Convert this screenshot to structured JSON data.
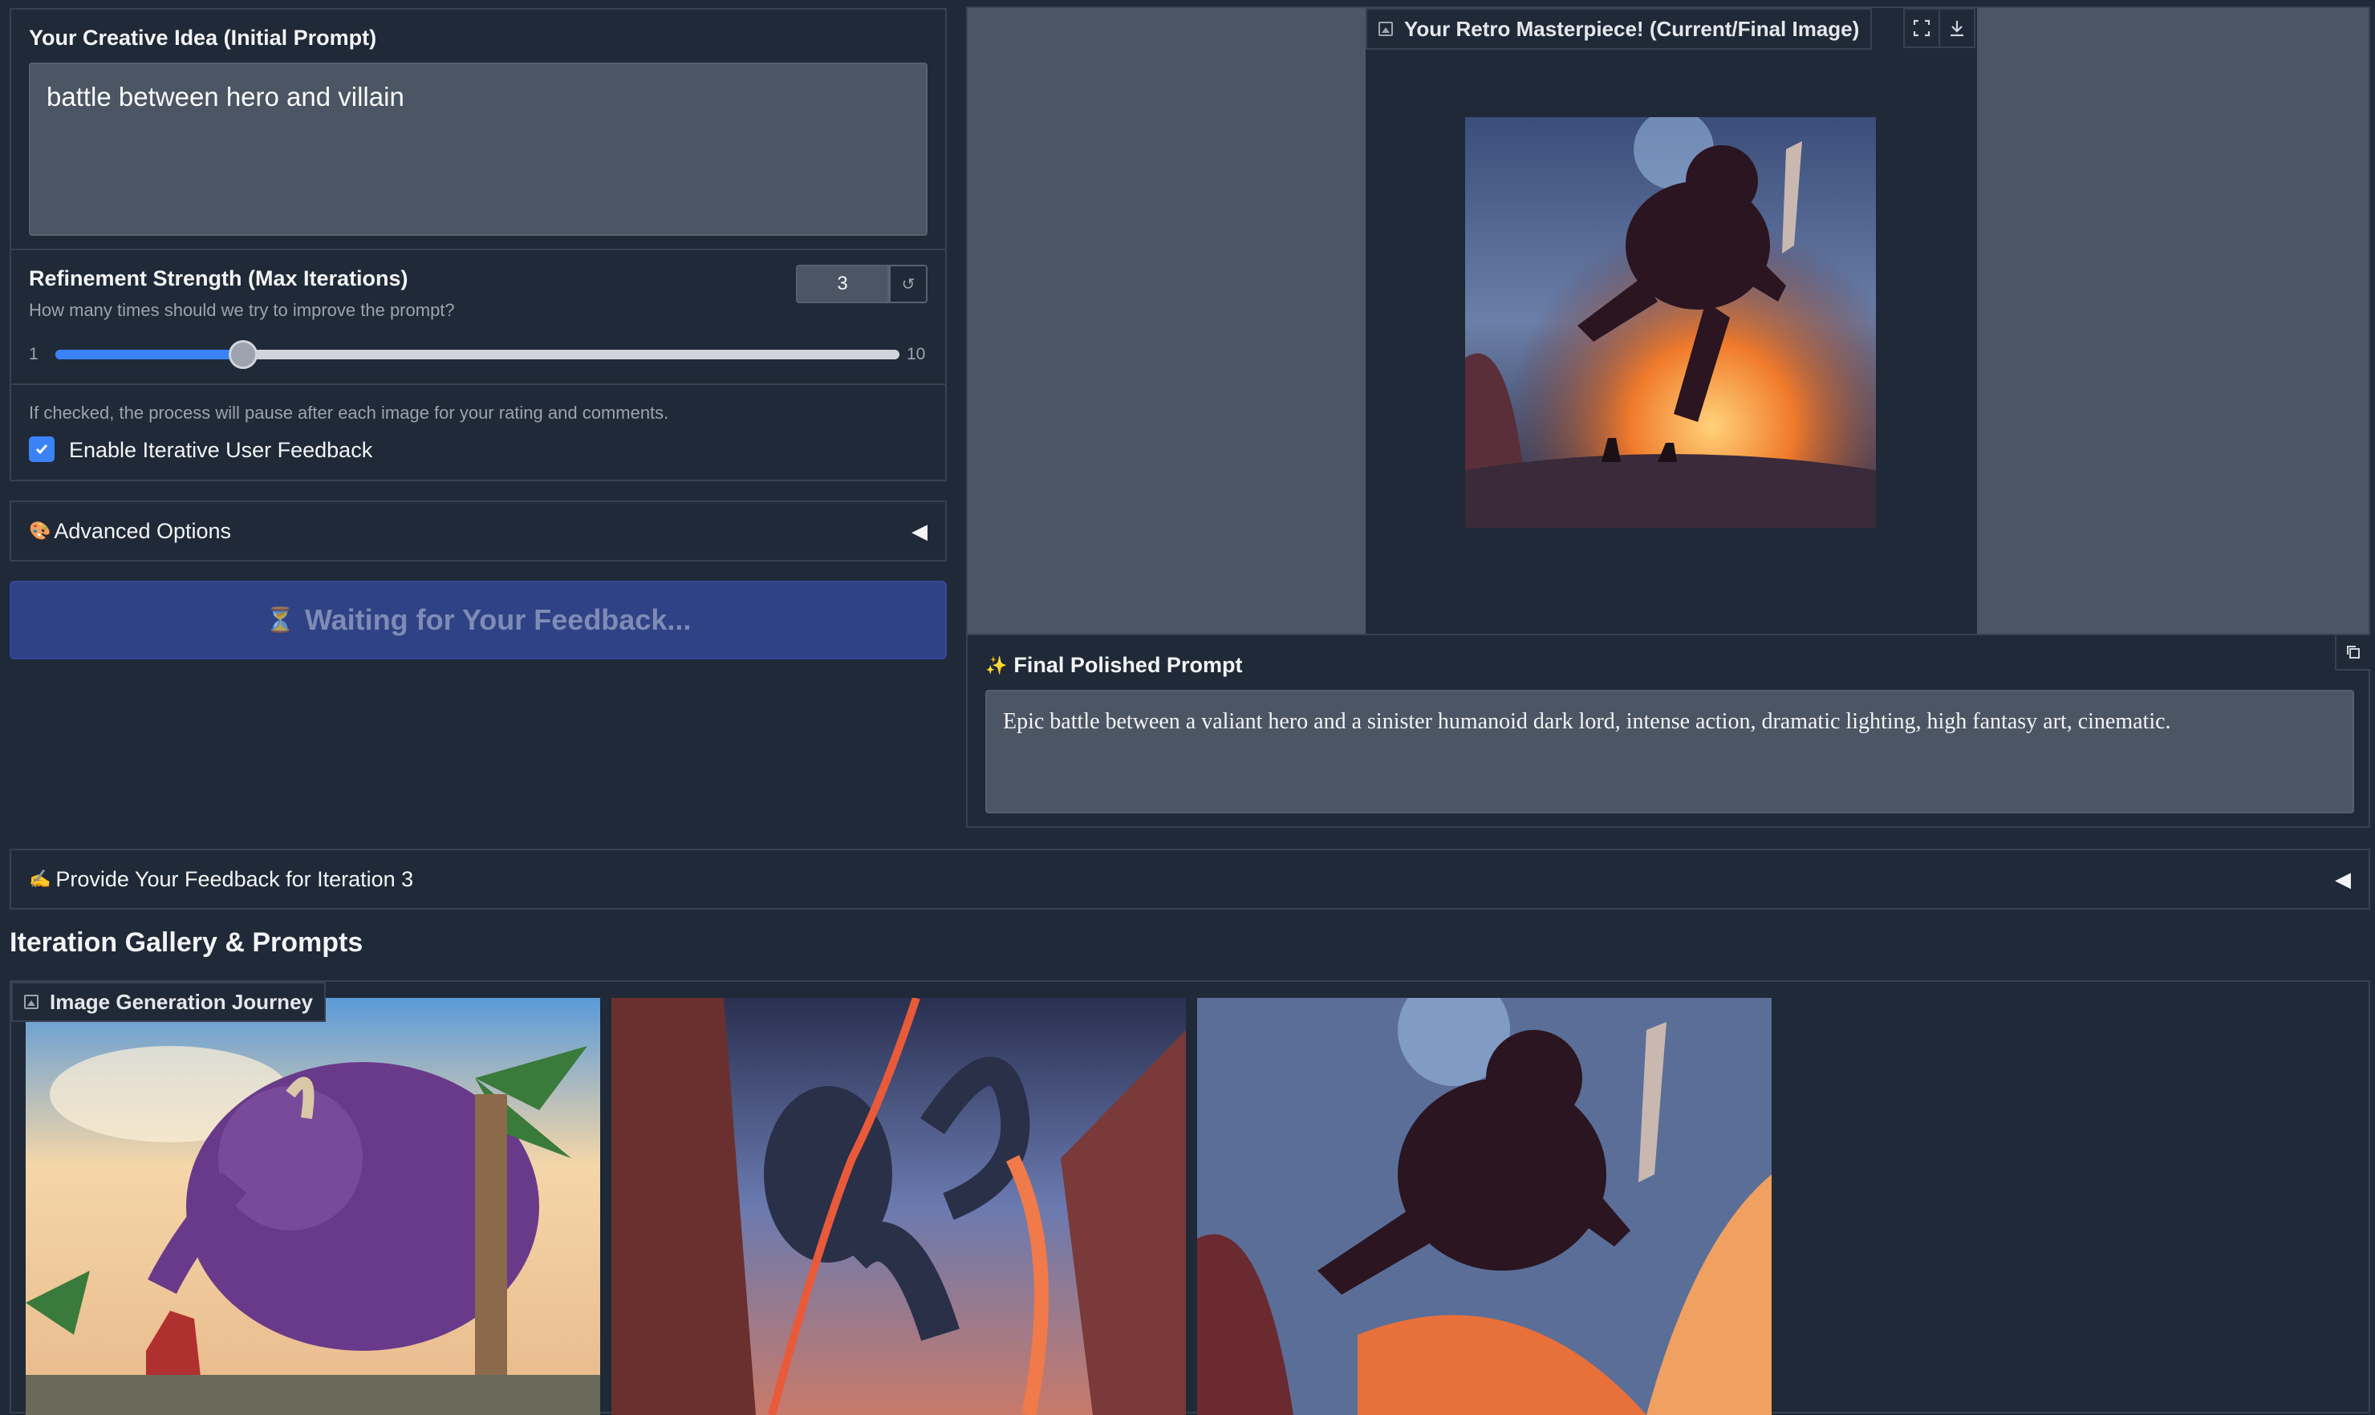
{
  "prompt": {
    "label": "Your Creative Idea (Initial Prompt)",
    "value": "battle between hero and villain"
  },
  "refinement": {
    "label": "Refinement Strength (Max Iterations)",
    "info": "How many times should we try to improve the prompt?",
    "value": "3",
    "reset_glyph": "↺",
    "min": "1",
    "max": "10",
    "fraction": 0.2222
  },
  "feedback_toggle": {
    "info": "If checked, the process will pause after each image for your rating and comments.",
    "label": "Enable Iterative User Feedback",
    "checked": true
  },
  "advanced": {
    "icon": "🎨",
    "label": "Advanced Options",
    "arrow": "◀"
  },
  "wait_button": {
    "icon": "⏳",
    "label": "Waiting for Your Feedback..."
  },
  "current_image": {
    "label": "Your Retro Masterpiece! (Current/Final Image)"
  },
  "final_prompt": {
    "icon": "✨",
    "label": "Final Polished Prompt",
    "value": "Epic battle between a valiant hero and a sinister humanoid dark lord, intense action, dramatic lighting, high fantasy art, cinematic."
  },
  "feedback_accordion": {
    "icon": "✍️",
    "label": "Provide Your Feedback for Iteration 3",
    "arrow": "◀"
  },
  "gallery": {
    "heading": "Iteration Gallery & Prompts",
    "label": "Image Generation Journey"
  },
  "colors": {
    "background": "#1f2937",
    "input": "#4b5563",
    "accent": "#3b82f6",
    "button": "#2f4285"
  }
}
